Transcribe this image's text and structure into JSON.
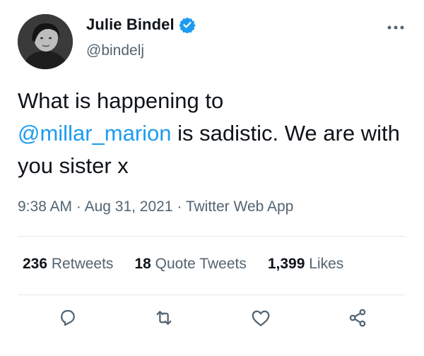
{
  "author": {
    "name": "Julie Bindel",
    "handle": "@bindelj"
  },
  "tweet": {
    "text_before": "What is happening to",
    "mention": "@millar_marion",
    "text_after": " is sadistic. We are with you sister x",
    "time": "9:38 AM",
    "date": "Aug 31, 2021",
    "source": "Twitter Web App"
  },
  "stats": {
    "retweets_count": "236",
    "retweets_label": "Retweets",
    "quotes_count": "18",
    "quotes_label": "Quote Tweets",
    "likes_count": "1,399",
    "likes_label": "Likes"
  },
  "colors": {
    "accent": "#1d9bf0",
    "secondary_text": "#536471",
    "primary_text": "#0f1419"
  },
  "icons": [
    "verified-badge-icon",
    "more-options-icon",
    "reply-icon",
    "retweet-icon",
    "like-icon",
    "share-icon"
  ]
}
